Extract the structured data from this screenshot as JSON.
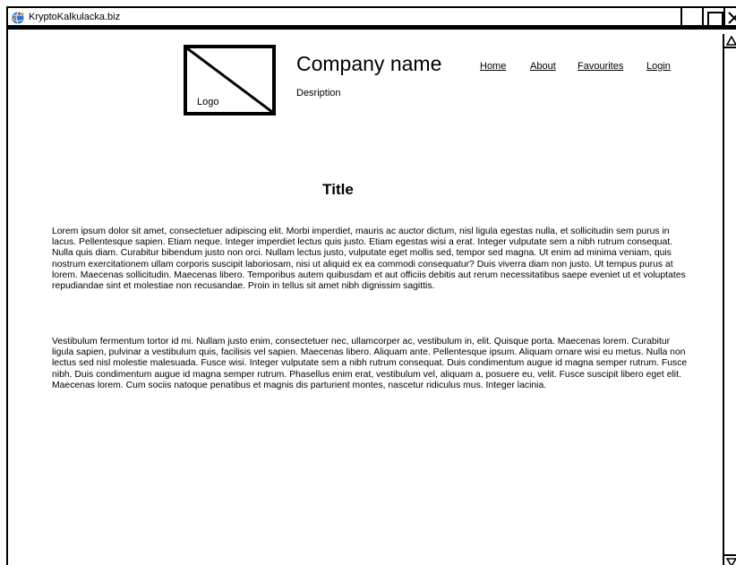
{
  "window": {
    "title": "KryptoKalkulacka.biz",
    "icon": "browser-globe-icon"
  },
  "header": {
    "logo_label": "Logo",
    "company_name": "Company name",
    "description": "Desription",
    "nav": [
      "Home",
      "About",
      "Favourites",
      "Login"
    ]
  },
  "main": {
    "title": "Title",
    "paragraphs": [
      "Lorem ipsum dolor sit amet, consectetuer adipiscing elit. Morbi imperdiet, mauris ac auctor dictum, nisl ligula egestas nulla, et sollicitudin sem purus in lacus. Pellentesque sapien. Etiam neque. Integer imperdiet lectus quis justo. Etiam egestas wisi a erat. Integer vulputate sem a nibh rutrum consequat. Nulla quis diam. Curabitur bibendum justo non orci. Nullam lectus justo, vulputate eget mollis sed, tempor sed magna. Ut enim ad minima veniam, quis nostrum exercitationem ullam corporis suscipit laboriosam, nisi ut aliquid ex ea commodi consequatur? Duis viverra diam non justo. Ut tempus purus at lorem. Maecenas sollicitudin. Maecenas libero. Temporibus autem quibusdam et aut officiis debitis aut rerum necessitatibus saepe eveniet ut et voluptates repudiandae sint et molestiae non recusandae. Proin in tellus sit amet nibh dignissim sagittis.",
      "Vestibulum fermentum tortor id mi. Nullam justo enim, consectetuer nec, ullamcorper ac, vestibulum in, elit. Quisque porta. Maecenas lorem. Curabitur ligula sapien, pulvinar a vestibulum quis, facilisis vel sapien. Maecenas libero. Aliquam ante. Pellentesque ipsum. Aliquam ornare wisi eu metus. Nulla non lectus sed nisl molestie malesuada. Fusce wisi. Integer vulputate sem a nibh rutrum consequat. Duis condimentum augue id magna semper rutrum. Fusce nibh. Duis condimentum augue id magna semper rutrum. Phasellus enim erat, vestibulum vel, aliquam a, posuere eu, velit. Fusce suscipit libero eget elit. Maecenas lorem. Cum sociis natoque penatibus et magnis dis parturient montes, nascetur ridiculus mus. Integer lacinia."
    ]
  },
  "colors": {
    "ink": "#000000",
    "background": "#ffffff",
    "icon_blue": "#1e6fd9",
    "icon_orange": "#f0a020"
  }
}
